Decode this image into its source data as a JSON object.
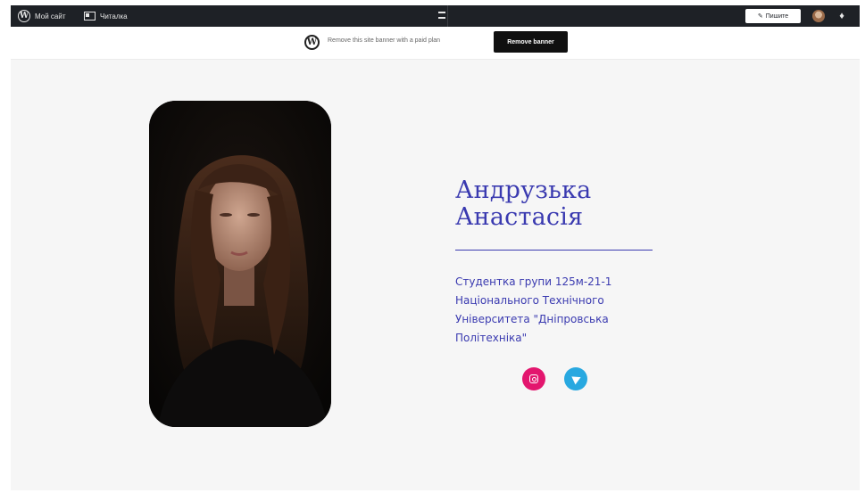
{
  "adminbar": {
    "my_site_label": "Мой сайт",
    "reader_label": "Читалка",
    "write_label": "Пишите",
    "wp_icon": "wordpress-icon",
    "reader_icon": "reader-icon",
    "bell_icon": "notifications-icon"
  },
  "banner": {
    "text": "Remove this site banner with a paid plan",
    "button_label": "Remove banner"
  },
  "profile": {
    "name_line1": "Андрузька",
    "name_line2": "Анастасія",
    "bio_lines": [
      "Студентка групи 125м-21-1",
      "Національного Технічного",
      "Університета \"Дніпровська",
      "Політехніка\""
    ]
  },
  "social": {
    "instagram_icon": "instagram-icon",
    "telegram_icon": "telegram-icon"
  },
  "colors": {
    "accent": "#3a3ab0",
    "admin_bar": "#1e2126",
    "instagram": "#e3166e",
    "telegram": "#28a8e0"
  }
}
